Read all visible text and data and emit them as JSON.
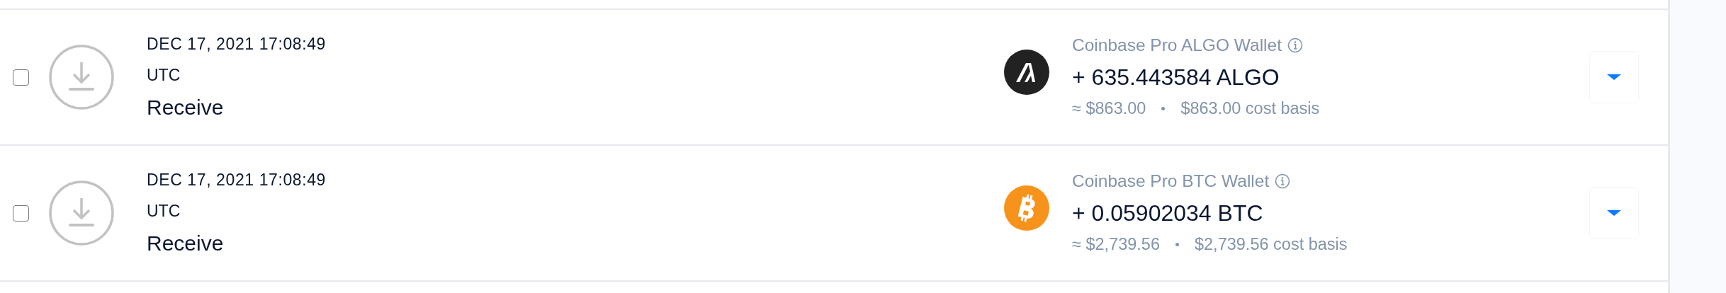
{
  "transactions": [
    {
      "checked": false,
      "date": "DEC 17, 2021 17:08:49",
      "timezone": "UTC",
      "type": "Receive",
      "kind": "algo",
      "wallet": "Coinbase Pro ALGO Wallet",
      "amount": "+ 635.443584 ALGO",
      "value": "≈ $863.00",
      "cost_basis": "$863.00 cost basis"
    },
    {
      "checked": false,
      "date": "DEC 17, 2021 17:08:49",
      "timezone": "UTC",
      "type": "Receive",
      "kind": "btc",
      "wallet": "Coinbase Pro BTC Wallet",
      "amount": "+ 0.05902034 BTC",
      "value": "≈ $2,739.56",
      "cost_basis": "$2,739.56 cost basis"
    }
  ]
}
